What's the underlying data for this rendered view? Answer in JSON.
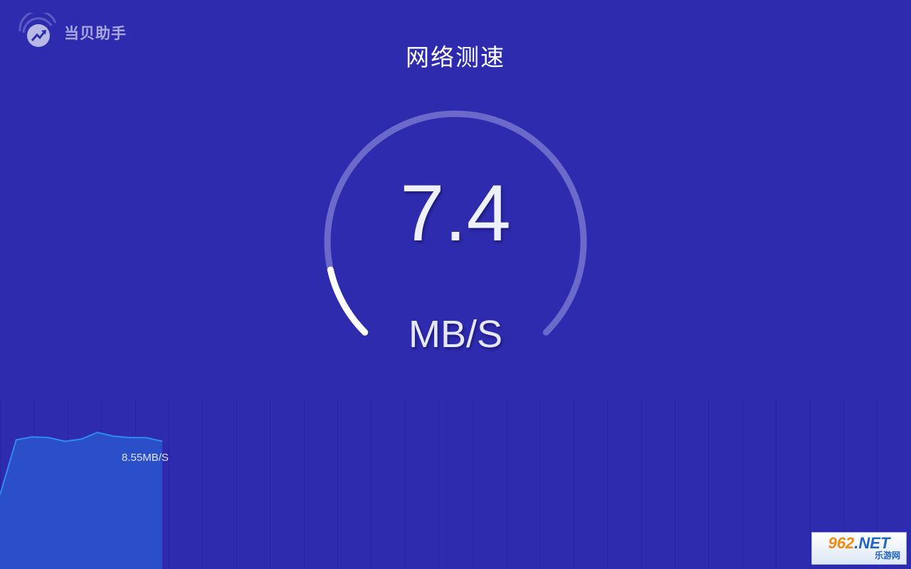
{
  "app": {
    "brand_name": "当贝助手",
    "logo_icon": "speed-trend-icon"
  },
  "page": {
    "title": "网络测速"
  },
  "gauge": {
    "value": "7.4",
    "unit": "MB/S",
    "progress_fraction": 0.12,
    "track_color": "#6b69c9",
    "progress_color": "#ffffff"
  },
  "history": {
    "current_label": "8.55MB/S",
    "line_color": "#2f8cf0",
    "fill_color": "#2a4fc8",
    "samples_MBps": [
      5.0,
      8.7,
      8.9,
      8.85,
      8.6,
      8.75,
      9.2,
      8.95,
      8.85,
      8.85,
      8.6
    ]
  },
  "watermark": {
    "prefix": "962",
    "suffix": ".NET",
    "subtitle": "乐游网"
  }
}
